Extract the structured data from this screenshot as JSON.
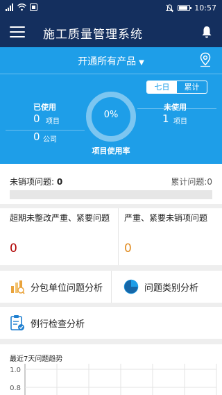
{
  "status_bar": {
    "time": "10:57",
    "battery_level": 0.85,
    "left_icons": [
      "signal-icon",
      "wifi-icon",
      "notification-icon"
    ],
    "right_icons": [
      "mute-icon",
      "battery-icon"
    ]
  },
  "app_bar": {
    "title": "施工质量管理系统",
    "icons": [
      "menu-icon",
      "bell-icon"
    ]
  },
  "header": {
    "product_selector": "开通所有产品",
    "icons": [
      "chevron-down-icon",
      "location-pin-icon"
    ],
    "tabs": [
      {
        "label": "七日",
        "active": true
      },
      {
        "label": "累计",
        "active": false
      }
    ]
  },
  "usage": {
    "used_label": "已使用",
    "used_projects": "0",
    "projects_unit": "项目",
    "used_companies": "0",
    "companies_unit": "公司",
    "unused_label": "未使用",
    "unused_projects": "1",
    "unused_unit": "项目",
    "rate_text": "0%",
    "rate_value": 0,
    "rate_label": "项目使用率"
  },
  "issues": {
    "unclosed_label": "未销项问题:",
    "unclosed_value": "0",
    "cumulative_text": "累计问题:0",
    "progress": 0
  },
  "severe": {
    "overdue_label": "超期未整改严重、紧要问题",
    "overdue_value": "0",
    "overdue_color": "#b00000",
    "unclosed_severe_label": "严重、紧要未销项问题",
    "unclosed_severe_value": "0",
    "unclosed_severe_color": "#e08a1e"
  },
  "actions": {
    "subcontractor": "分包单位问题分析",
    "category": "问题类别分析",
    "routine": "例行检查分析",
    "icons": [
      "bar-chart-icon",
      "pie-chart-icon",
      "clipboard-check-icon"
    ]
  },
  "trend": {
    "title": "最近7天问题趋势"
  },
  "chart_data": {
    "type": "line",
    "title": "最近7天问题趋势",
    "y_ticks": [
      "1.0",
      "0.8"
    ],
    "ylim": [
      0,
      1.0
    ],
    "grid": true
  },
  "colors": {
    "nav": "#142f5e",
    "accent": "#1e9ee8",
    "background": "#eeeeee"
  }
}
